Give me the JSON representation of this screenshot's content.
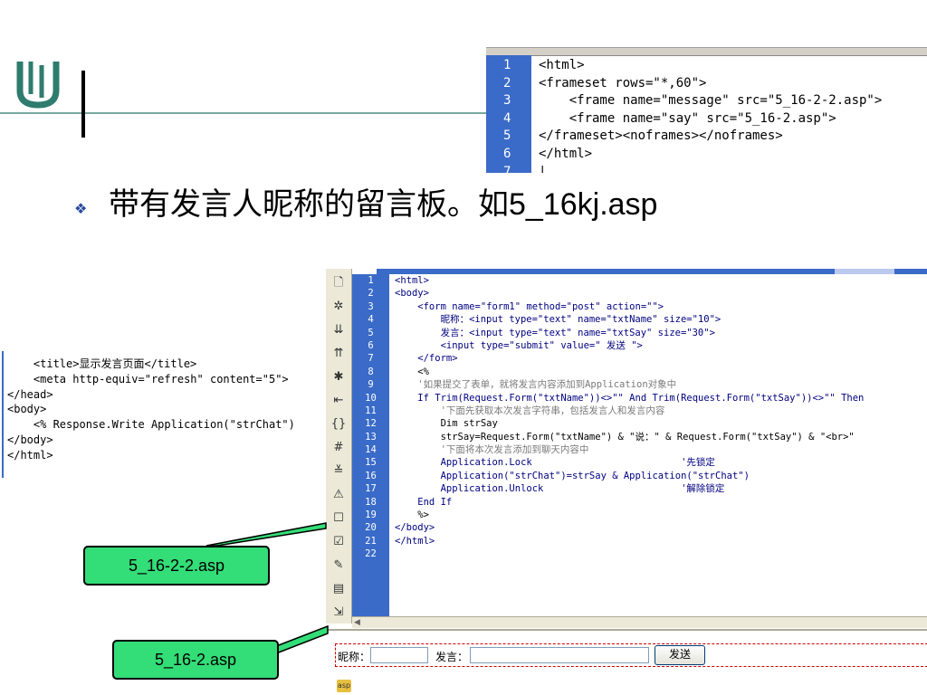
{
  "slide": {
    "bullet_icon": "❖",
    "title_cn": "带有发言人昵称的留言板。如",
    "title_file": "5_16kj.asp"
  },
  "frameset_code": {
    "lines": [
      {
        "n": "1",
        "text": "<html>"
      },
      {
        "n": "2",
        "text": "<frameset rows=\"*,60\">"
      },
      {
        "n": "3",
        "text": "    <frame name=\"message\" src=\"5_16-2-2.asp\">"
      },
      {
        "n": "4",
        "text": "    <frame name=\"say\" src=\"5_16-2.asp\">"
      },
      {
        "n": "5",
        "text": "</frameset><noframes></noframes>"
      },
      {
        "n": "6",
        "text": "</html>"
      },
      {
        "n": "7",
        "text": "|"
      }
    ]
  },
  "head_code": {
    "lines": [
      "    <title>显示发言页面</title>",
      "    <meta http-equiv=\"refresh\" content=\"5\">",
      "</head>",
      "<body>",
      "    <% Response.Write Application(\"strChat\")",
      "</body>",
      "</html>"
    ]
  },
  "editor": {
    "toolbar_icons": [
      "page-icon",
      "gear-icon",
      "collapse-icon",
      "expand-icon",
      "asterisk-icon",
      "indent-icon",
      "braces-icon",
      "hash-icon",
      "syntax-icon",
      "warning-icon",
      "comment-icon",
      "uncomment-icon",
      "pencil-icon",
      "format-icon",
      "wrap-icon",
      "more-icon"
    ],
    "lines": [
      {
        "n": "1",
        "text": "<html>",
        "kind": "tag"
      },
      {
        "n": "2",
        "text": "<body>",
        "kind": "tag"
      },
      {
        "n": "3",
        "text": "    <form name=\"form1\" method=\"post\" action=\"\">",
        "kind": "tag"
      },
      {
        "n": "4",
        "text": "        昵称：<input type=\"text\" name=\"txtName\" size=\"10\">",
        "kind": "tag"
      },
      {
        "n": "5",
        "text": "        发言：<input type=\"text\" name=\"txtSay\" size=\"30\">",
        "kind": "tag"
      },
      {
        "n": "6",
        "text": "        <input type=\"submit\" value=\" 发送 \">",
        "kind": "tag"
      },
      {
        "n": "7",
        "text": "    </form>",
        "kind": "tag"
      },
      {
        "n": "8",
        "text": "    <%",
        "kind": "blk"
      },
      {
        "n": "9",
        "text": "    '如果提交了表单，就将发言内容添加到Application对象中",
        "kind": "cmt"
      },
      {
        "n": "10",
        "text": "    If Trim(Request.Form(\"txtName\"))<>\"\" And Trim(Request.Form(\"txtSay\"))<>\"\" Then",
        "kind": "vb"
      },
      {
        "n": "11",
        "text": "        '下面先获取本次发言字符串，包括发言人和发言内容",
        "kind": "cmt"
      },
      {
        "n": "12",
        "text": "        Dim strSay",
        "kind": "blk"
      },
      {
        "n": "13",
        "text": "        strSay=Request.Form(\"txtName\") & \"说：\" & Request.Form(\"txtSay\") & \"<br>\"",
        "kind": "blk"
      },
      {
        "n": "14",
        "text": "        '下面将本次发言添加到聊天内容中",
        "kind": "cmt"
      },
      {
        "n": "15",
        "text": "        Application.Lock                          '先锁定",
        "kind": "vb"
      },
      {
        "n": "16",
        "text": "        Application(\"strChat\")=strSay & Application(\"strChat\")",
        "kind": "vb"
      },
      {
        "n": "17",
        "text": "        Application.Unlock                        '解除锁定",
        "kind": "vb"
      },
      {
        "n": "18",
        "text": "    End If",
        "kind": "vb"
      },
      {
        "n": "19",
        "text": "    %>",
        "kind": "blk"
      },
      {
        "n": "20",
        "text": "</body>",
        "kind": "tag"
      },
      {
        "n": "21",
        "text": "</html>",
        "kind": "tag"
      },
      {
        "n": "22",
        "text": "",
        "kind": "blk"
      }
    ]
  },
  "design_form": {
    "nick_label": "昵称：",
    "say_label": "发言：",
    "send_label": "发送",
    "asp_icon": "asp"
  },
  "callouts": {
    "frame1": "5_16-2-2.asp",
    "frame2": "5_16-2.asp"
  },
  "colors": {
    "gutter": "#3a6bc8",
    "callout_fill": "#33dd77",
    "logo": "#2e7c6e"
  }
}
